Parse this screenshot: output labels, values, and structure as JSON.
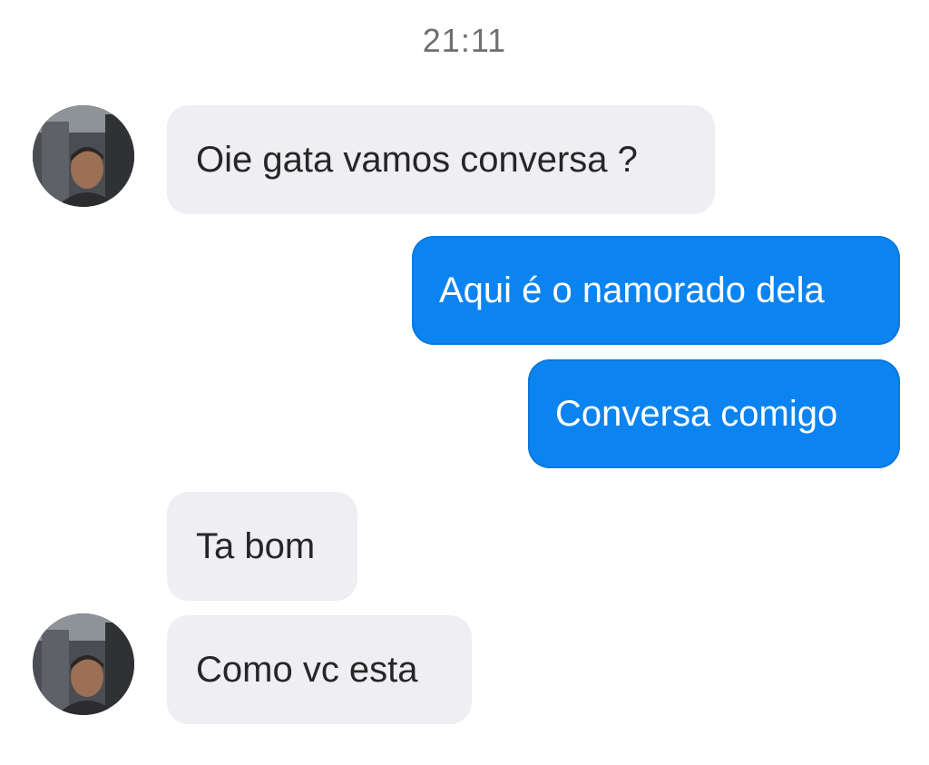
{
  "conversation": {
    "timestamp": "21:11",
    "messages": [
      {
        "sender": "contact",
        "text": "Oie gata vamos conversa ?"
      },
      {
        "sender": "me",
        "text": "Aqui é o namorado dela"
      },
      {
        "sender": "me",
        "text": "Conversa comigo"
      },
      {
        "sender": "contact",
        "text": "Ta bom"
      },
      {
        "sender": "contact",
        "text": "Como vc esta"
      }
    ]
  },
  "colors": {
    "incoming_bubble": "#eeeef3",
    "outgoing_bubble": "#0b84f1",
    "timestamp_text": "#6f6f6f"
  },
  "icons": {
    "contact_avatar": "avatar-photo-icon"
  }
}
